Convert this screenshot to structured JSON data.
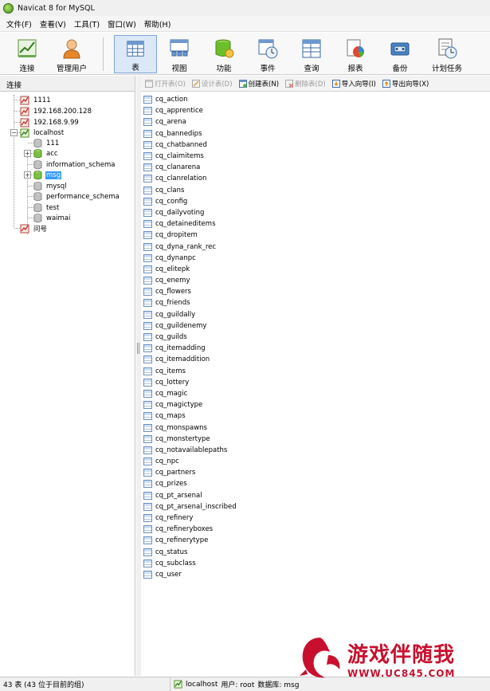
{
  "window": {
    "title": "Navicat 8 for MySQL"
  },
  "menu": [
    {
      "label": "文件(F)"
    },
    {
      "label": "查看(V)"
    },
    {
      "label": "工具(T)"
    },
    {
      "label": "窗口(W)"
    },
    {
      "label": "帮助(H)"
    }
  ],
  "toolbar": [
    {
      "label": "连接",
      "icon": "connection-icon"
    },
    {
      "label": "管理用户",
      "icon": "user-icon"
    },
    {
      "label": "表",
      "icon": "table-icon",
      "active": true
    },
    {
      "label": "视图",
      "icon": "view-icon"
    },
    {
      "label": "功能",
      "icon": "function-icon"
    },
    {
      "label": "事件",
      "icon": "event-icon"
    },
    {
      "label": "查询",
      "icon": "query-icon"
    },
    {
      "label": "报表",
      "icon": "report-icon"
    },
    {
      "label": "备份",
      "icon": "backup-icon"
    },
    {
      "label": "计划任务",
      "icon": "schedule-icon"
    }
  ],
  "left_panel": {
    "header": "连接",
    "tree": [
      {
        "label": "1111",
        "type": "connection"
      },
      {
        "label": "192.168.200.128",
        "type": "connection"
      },
      {
        "label": "192.168.9.99",
        "type": "connection"
      },
      {
        "label": "localhost",
        "type": "connection-open",
        "expanded": true
      },
      {
        "label": "111",
        "type": "database"
      },
      {
        "label": "acc",
        "type": "database-open"
      },
      {
        "label": "information_schema",
        "type": "database"
      },
      {
        "label": "msg",
        "type": "database-open",
        "selected": true
      },
      {
        "label": "mysql",
        "type": "database"
      },
      {
        "label": "performance_schema",
        "type": "database"
      },
      {
        "label": "test",
        "type": "database"
      },
      {
        "label": "waimai",
        "type": "database"
      },
      {
        "label": "问号",
        "type": "connection"
      }
    ]
  },
  "object_toolbar": [
    {
      "label": "打开表(O)",
      "enabled": false,
      "icon": "open-table-icon"
    },
    {
      "label": "设计表(D)",
      "enabled": false,
      "icon": "design-table-icon"
    },
    {
      "label": "创建表(N)",
      "enabled": true,
      "icon": "create-table-icon"
    },
    {
      "label": "删除表(D)",
      "enabled": false,
      "icon": "delete-table-icon"
    },
    {
      "label": "导入向导(I)",
      "enabled": true,
      "icon": "import-wizard-icon"
    },
    {
      "label": "导出向导(X)",
      "enabled": true,
      "icon": "export-wizard-icon"
    }
  ],
  "tables": [
    "cq_action",
    "cq_apprentice",
    "cq_arena",
    "cq_bannedips",
    "cq_chatbanned",
    "cq_claimitems",
    "cq_clanarena",
    "cq_clanrelation",
    "cq_clans",
    "cq_config",
    "cq_dailyvoting",
    "cq_detaineditems",
    "cq_dropitem",
    "cq_dyna_rank_rec",
    "cq_dynanpc",
    "cq_elitepk",
    "cq_enemy",
    "cq_flowers",
    "cq_friends",
    "cq_guildally",
    "cq_guildenemy",
    "cq_guilds",
    "cq_itemadding",
    "cq_itemaddition",
    "cq_items",
    "cq_lottery",
    "cq_magic",
    "cq_magictype",
    "cq_maps",
    "cq_monspawns",
    "cq_monstertype",
    "cq_notavailablepaths",
    "cq_npc",
    "cq_partners",
    "cq_prizes",
    "cq_pt_arsenal",
    "cq_pt_arsenal_inscribed",
    "cq_refinery",
    "cq_refineryboxes",
    "cq_refinerytype",
    "cq_status",
    "cq_subclass",
    "cq_user"
  ],
  "status": {
    "count": "43 表 (43 位于目前的组)",
    "connection": "localhost",
    "user": "用户: root",
    "database": "数据库: msg"
  },
  "watermark": {
    "text": "游戏伴随我",
    "url": "WWW.UC845.COM"
  }
}
